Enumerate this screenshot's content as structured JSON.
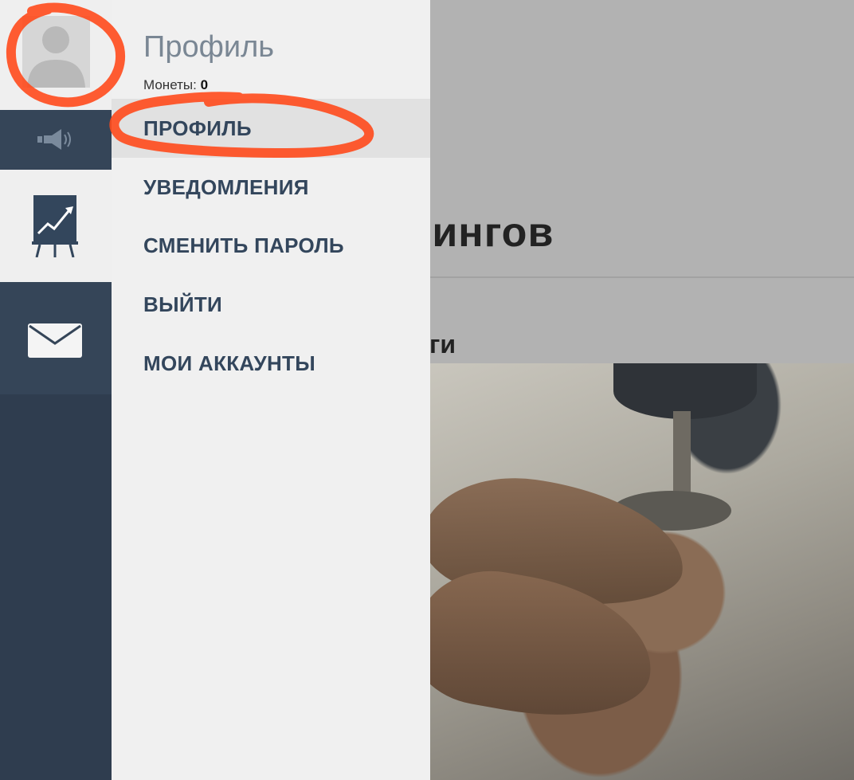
{
  "background": {
    "heading_fragment": "енингов",
    "subheading_fragment": "инги"
  },
  "rail": {
    "icons": [
      "avatar-icon",
      "speaker-icon",
      "chart-icon",
      "mail-icon"
    ]
  },
  "menu": {
    "title": "Профиль",
    "coins_label": "Монеты:",
    "coins_value": "0",
    "items": [
      {
        "label": "ПРОФИЛЬ",
        "active": true
      },
      {
        "label": "УВЕДОМЛЕНИЯ"
      },
      {
        "label": "СМЕНИТЬ ПАРОЛЬ"
      },
      {
        "label": "ВЫЙТИ"
      },
      {
        "label": "МОИ АККАУНТЫ"
      }
    ]
  },
  "colors": {
    "rail_dark": "#2f3d4f",
    "menu_text": "#33465c",
    "annotation": "#ff4a1c"
  }
}
